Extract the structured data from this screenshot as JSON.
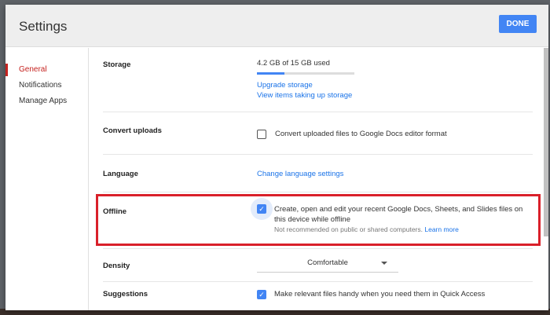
{
  "dialog": {
    "title": "Settings",
    "done_label": "DONE"
  },
  "sidebar": {
    "items": [
      {
        "label": "General",
        "active": true
      },
      {
        "label": "Notifications"
      },
      {
        "label": "Manage Apps"
      }
    ]
  },
  "storage": {
    "label": "Storage",
    "usage": "4.2 GB of 15 GB used",
    "used_fraction": 0.28,
    "upgrade": "Upgrade storage",
    "view_items": "View items taking up storage"
  },
  "convert": {
    "label": "Convert uploads",
    "checked": false,
    "text": "Convert uploaded files to Google Docs editor format"
  },
  "language": {
    "label": "Language",
    "link": "Change language settings"
  },
  "offline": {
    "label": "Offline",
    "checked": true,
    "text": "Create, open and edit your recent Google Docs, Sheets, and Slides files on this device while offline",
    "note": "Not recommended on public or shared computers.",
    "learn_more": "Learn more"
  },
  "density": {
    "label": "Density",
    "selected": "Comfortable"
  },
  "suggestions": {
    "label": "Suggestions",
    "checked": true,
    "text": "Make relevant files handy when you need them in Quick Access"
  },
  "colors": {
    "accent": "#4285f4",
    "active_nav": "#c5221f",
    "highlight": "#d9202a"
  }
}
